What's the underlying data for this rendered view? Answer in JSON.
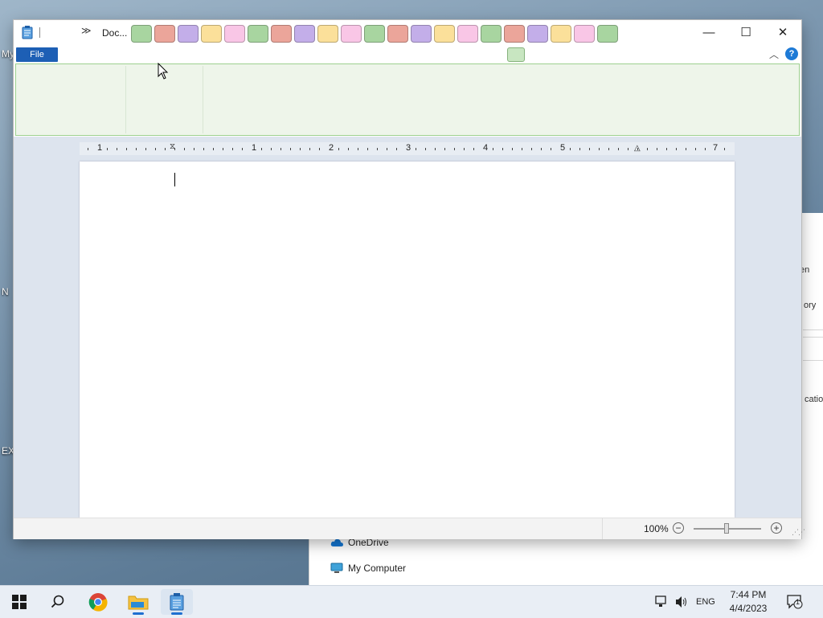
{
  "desktop": {
    "icons_partial": [
      "My",
      "N",
      "EX"
    ]
  },
  "background_window": {
    "fragments": [
      "en",
      "ory",
      "cation"
    ],
    "nav_items": [
      "OneDrive",
      "My Computer"
    ]
  },
  "window": {
    "title": "Doc...",
    "qat_more": "≫",
    "buttons": {
      "minimize": "—",
      "maximize": "☐",
      "close": "✕"
    },
    "file_tab": "File",
    "help": "?",
    "swatch_colors": [
      "#a8d5a0",
      "#eba59a",
      "#c3aee9",
      "#fbe09a",
      "#f9c6e6",
      "#a8d5a0",
      "#eba59a",
      "#c3aee9",
      "#fbe09a",
      "#f9c6e6",
      "#a8d5a0",
      "#eba59a",
      "#c3aee9",
      "#fbe09a",
      "#f9c6e6",
      "#a8d5a0",
      "#eba59a",
      "#c3aee9",
      "#fbe09a",
      "#f9c6e6",
      "#a8d5a0"
    ]
  },
  "ruler": {
    "labels": [
      "1",
      "1",
      "2",
      "3",
      "4",
      "5",
      "7"
    ]
  },
  "statusbar": {
    "zoom_label": "100%",
    "zoom_level_percent": 100,
    "zoom_out": "−",
    "zoom_in": "+"
  },
  "taskbar": {
    "language": "ENG",
    "time": "7:44 PM",
    "date": "4/4/2023",
    "notification_count": "1",
    "accent": "#1e6fd0"
  }
}
